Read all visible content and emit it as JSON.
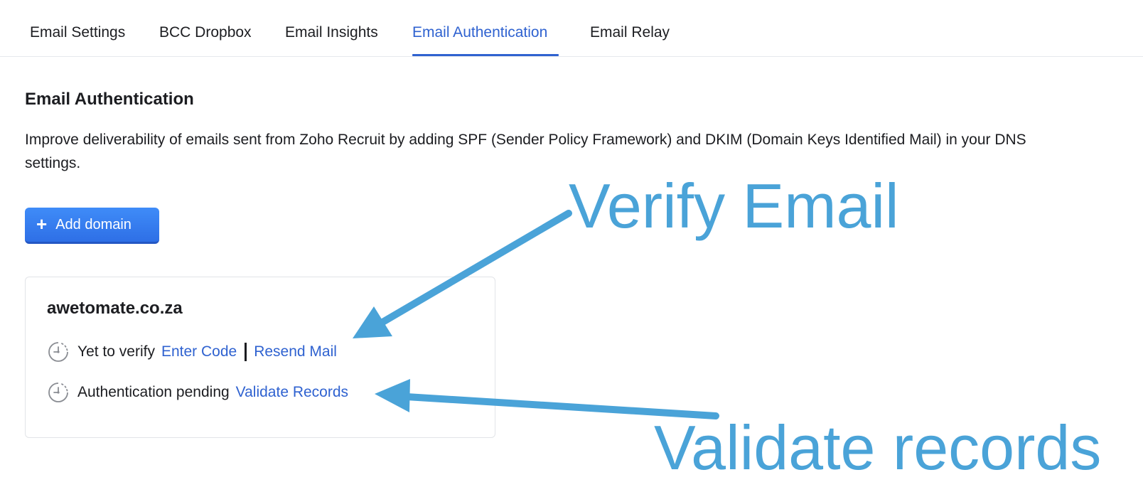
{
  "tabs": [
    {
      "label": "Email Settings",
      "active": false
    },
    {
      "label": "BCC Dropbox",
      "active": false
    },
    {
      "label": "Email Insights",
      "active": false
    },
    {
      "label": "Email Authentication",
      "active": true
    },
    {
      "label": "Email Relay",
      "active": false
    }
  ],
  "section": {
    "title": "Email Authentication",
    "description": "Improve deliverability of emails sent from Zoho Recruit by adding SPF (Sender Policy Framework) and DKIM (Domain Keys Identified Mail) in your DNS settings."
  },
  "add_domain_button": {
    "label": "Add domain",
    "icon": "plus-icon"
  },
  "domain_card": {
    "domain": "awetomate.co.za",
    "rows": [
      {
        "icon": "clock-icon",
        "status": "Yet to verify",
        "links": [
          "Enter Code",
          "Resend Mail"
        ]
      },
      {
        "icon": "clock-icon",
        "status": "Authentication pending",
        "links": [
          "Validate Records"
        ]
      }
    ]
  },
  "annotations": {
    "verify_email": "Verify Email",
    "validate_records": "Validate records",
    "color": "#4aa3d8"
  },
  "colors": {
    "accent": "#2f62d0",
    "button": "#3181f0",
    "text": "#1c1d21"
  }
}
